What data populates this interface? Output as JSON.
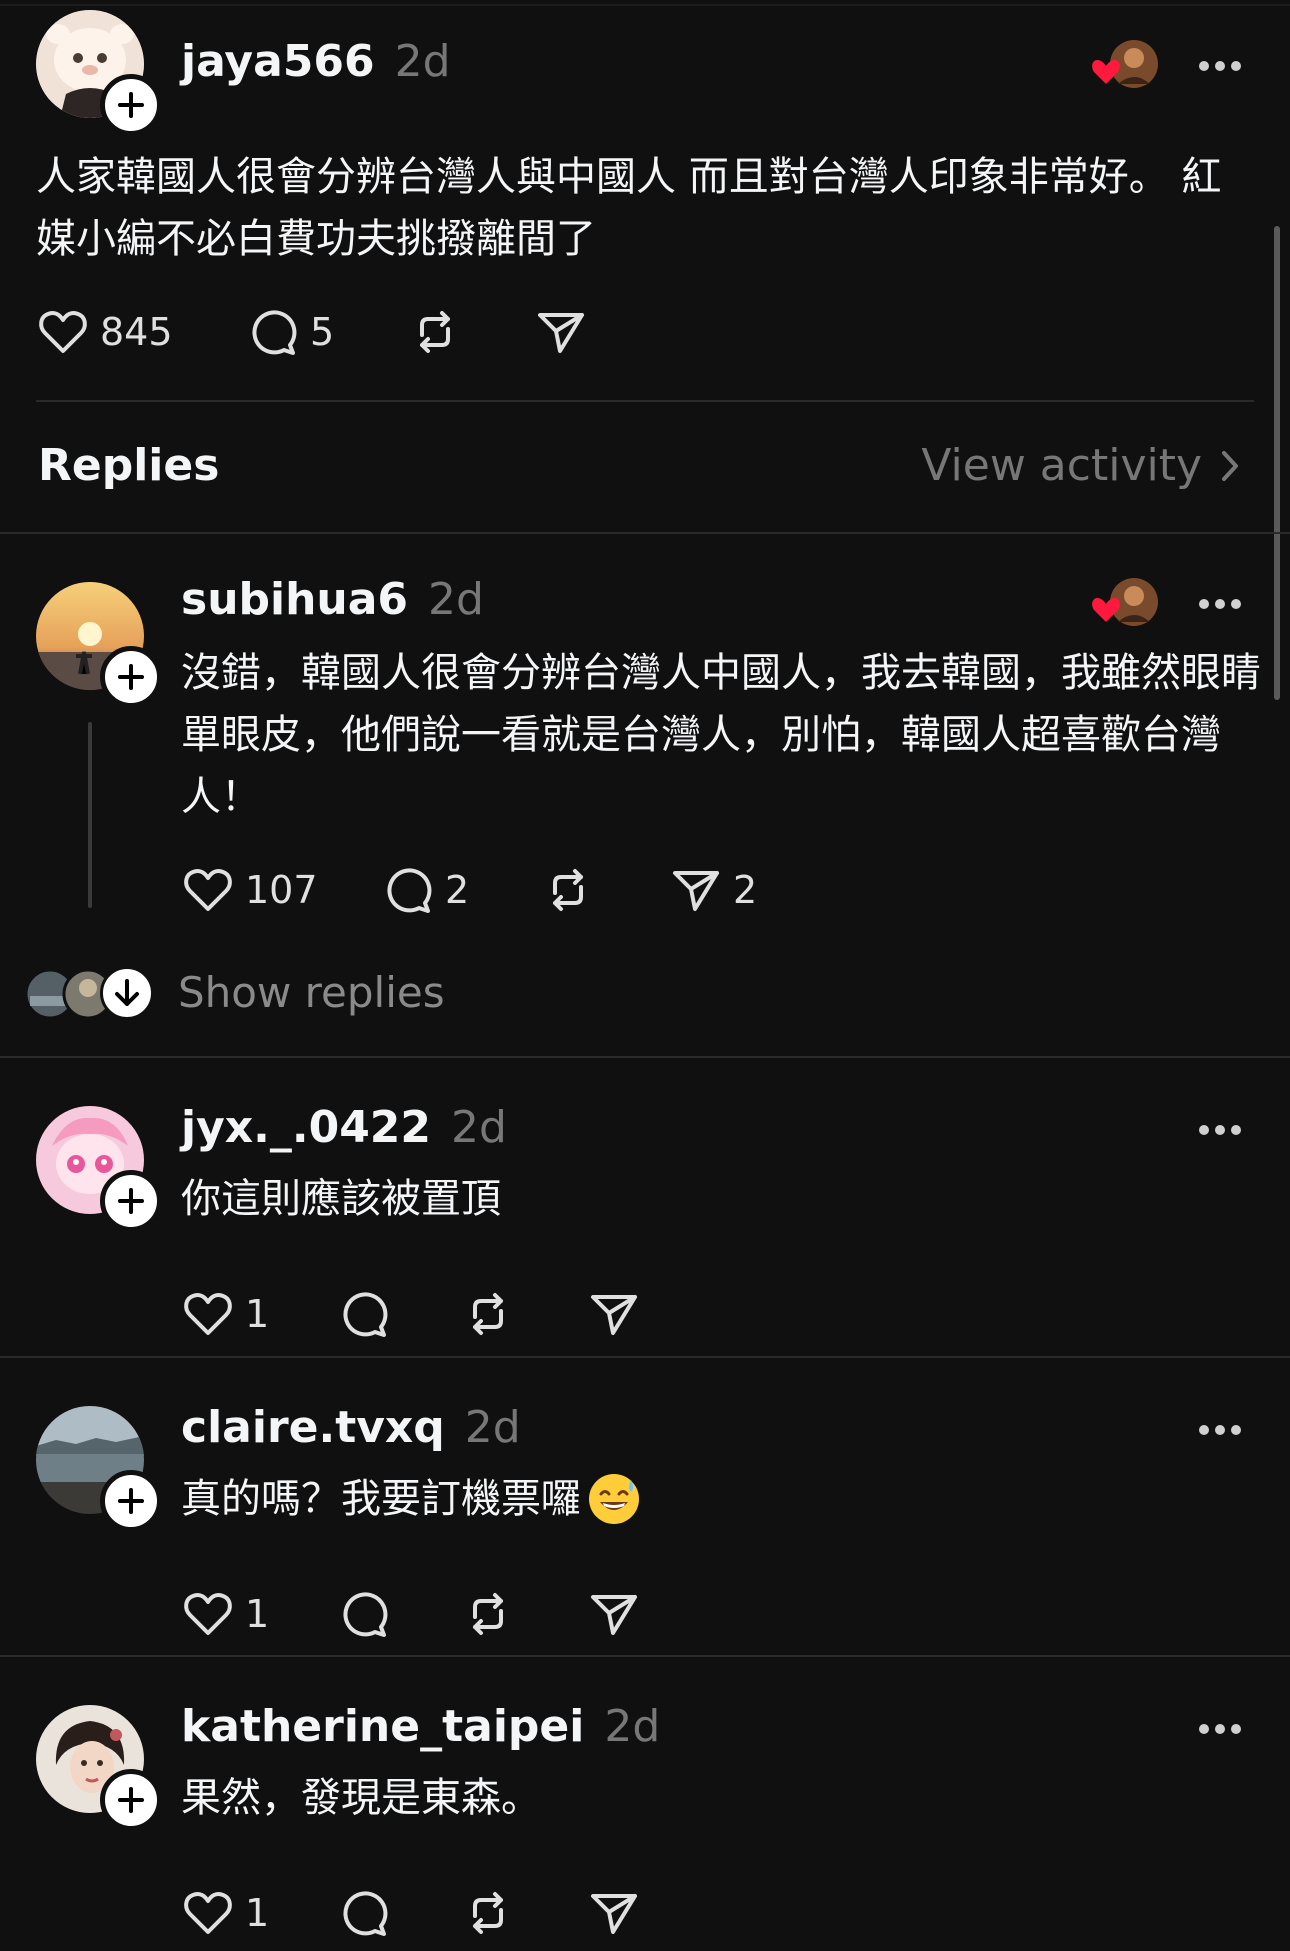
{
  "main_post": {
    "username": "jaya566",
    "time": "2d",
    "text_line1": "人家韓國人很會分辨台灣人與中國人 而且對台灣人印象非常好。 紅",
    "text_line2": "媒小編不必白費功夫挑撥離間了",
    "likes": "845",
    "comments": "5"
  },
  "replies_header": {
    "title": "Replies",
    "view_activity": "View activity"
  },
  "replies": [
    {
      "username": "subihua6",
      "time": "2d",
      "lines": [
        "沒錯，韓國人很會分辨台灣人中國人，我去韓國，我雖然眼睛",
        "單眼皮，他們說一看就是台灣人，別怕，韓國人超喜歡台灣",
        "人！"
      ],
      "likes": "107",
      "comments": "2",
      "shares": "2",
      "show_replies": "Show replies"
    },
    {
      "username": "jyx._.0422",
      "time": "2d",
      "lines": [
        "你這則應該被置頂"
      ],
      "likes": "1"
    },
    {
      "username": "claire.tvxq",
      "time": "2d",
      "lines": [
        "真的嗎？我要訂機票囉"
      ],
      "likes": "1"
    },
    {
      "username": "katherine_taipei",
      "time": "2d",
      "lines": [
        "果然，發現是東森。"
      ],
      "likes": "1"
    }
  ],
  "colors": {
    "background": "#101010",
    "text": "#f3f5f7",
    "muted": "#777777",
    "heart_red": "#ff1a3d"
  }
}
